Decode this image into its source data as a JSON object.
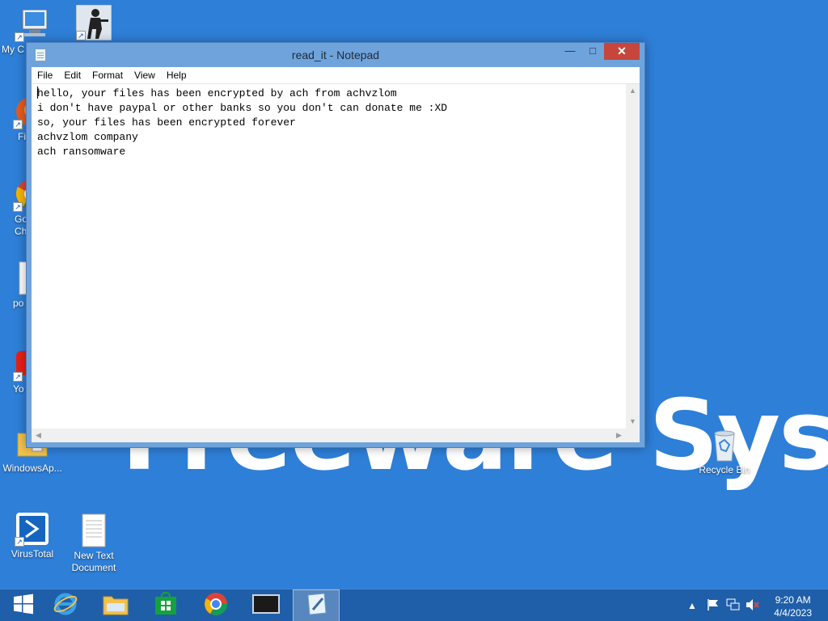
{
  "desktop": {
    "wallpaper_text": "Freeware Sys",
    "icons": [
      {
        "label": "My C"
      },
      {
        "label": ""
      },
      {
        "label": "Fi"
      },
      {
        "label": "Go Ch"
      },
      {
        "label": "po"
      },
      {
        "label": "Yo"
      },
      {
        "label": "WindowsAp..."
      },
      {
        "label": "VirusTotal"
      },
      {
        "label": "New Text Document"
      },
      {
        "label": "Recycle Bin"
      }
    ]
  },
  "notepad": {
    "title": "read_it - Notepad",
    "menu": [
      "File",
      "Edit",
      "Format",
      "View",
      "Help"
    ],
    "first_char": "h",
    "first_line_rest": "ello, your files has been encrypted by ach from achvzlom",
    "lines": [
      "i don't have paypal or other banks so you don't can donate me :XD",
      "so, your files has been encrypted forever",
      "achvzlom company",
      "ach ransomware"
    ],
    "window_buttons": {
      "minimize": "—",
      "maximize": "□",
      "close": "✕"
    }
  },
  "taskbar": {
    "items": [
      "start-icon",
      "internet-explorer-icon",
      "file-explorer-icon",
      "store-icon",
      "chrome-icon",
      "terminal-icon",
      "notepad-icon"
    ],
    "clock_time": "9:20 AM",
    "clock_date": "4/4/2023"
  },
  "colors": {
    "desktop_bg": "#2e7fd8",
    "taskbar_bg": "#1f5fa9",
    "window_frame": "#6fa3dc",
    "close_button": "#c7463b"
  }
}
